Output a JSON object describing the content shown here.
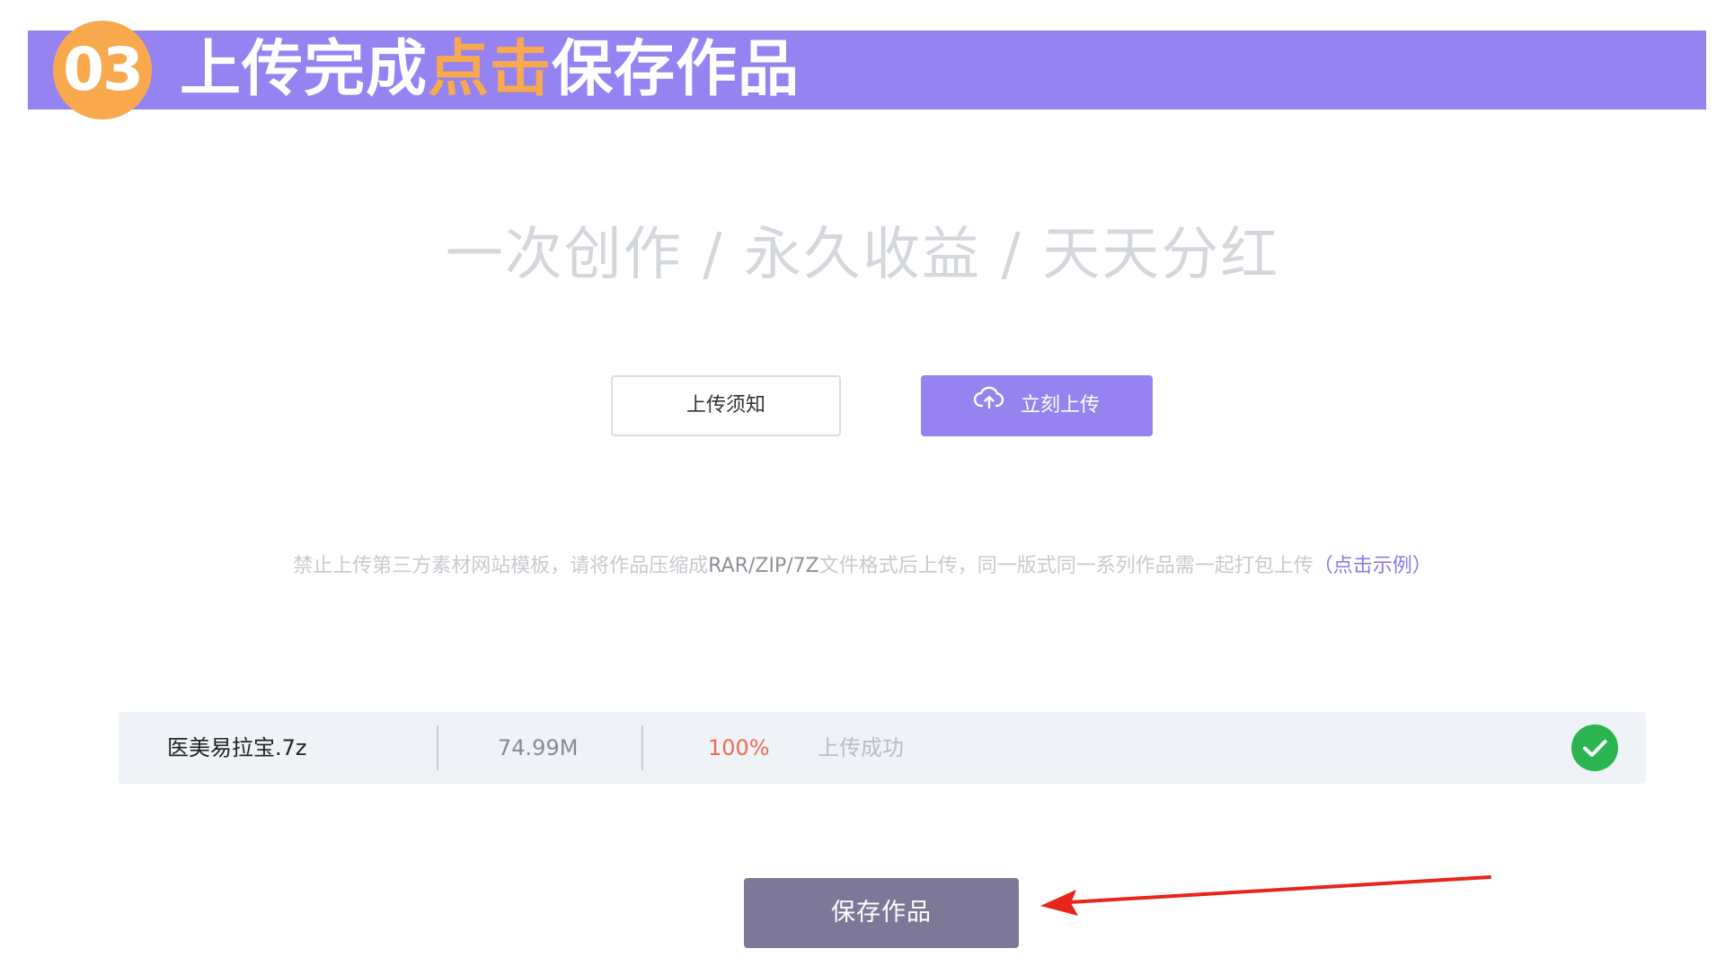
{
  "banner": {
    "step_number": "03",
    "title_part1": "上传完成",
    "title_highlight": "点击",
    "title_part2": "保存作品",
    "background_color": "#9483f1",
    "accent_color": "#f9a94d"
  },
  "slogan": "一次创作 / 永久收益 / 天天分红",
  "buttons": {
    "notice_label": "上传须知",
    "upload_label": "立刻上传",
    "upload_icon": "cloud-upload-icon",
    "upload_color": "#9683ef"
  },
  "notice": {
    "text_before": "禁止上传第三方素材网站模板，请将作品压缩成",
    "formats": "RAR/ZIP/7Z",
    "text_after": "文件格式后上传，同一版式同一系列作品需一起打包上传",
    "example_link": "（点击示例）"
  },
  "file": {
    "name": "医美易拉宝.7z",
    "size": "74.99M",
    "progress": "100%",
    "status": "上传成功",
    "status_icon": "check-circle-icon",
    "status_color": "#2ab550"
  },
  "save_button": {
    "label": "保存作品",
    "color": "#7e7898"
  },
  "annotation": {
    "arrow_color": "#e8251b"
  }
}
